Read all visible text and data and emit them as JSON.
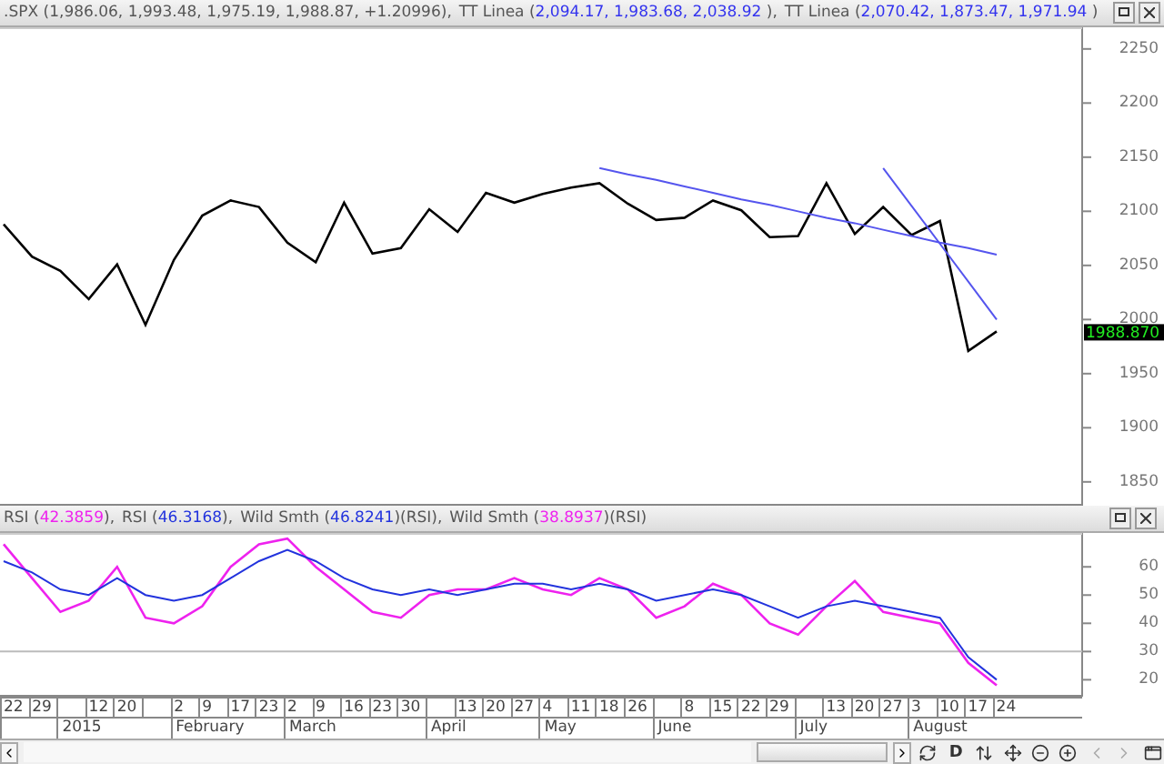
{
  "price_pane": {
    "legend": [
      {
        "name": ".SPX",
        "opening": " (",
        "values": "1,986.06, 1,993.48, 1,975.19, 1,988.87, +1.20996",
        "color": "#555555",
        "closing": "),"
      },
      {
        "name": "TT Linea",
        "opening": " (",
        "values": "2,094.17, 1,983.68, 2,038.92 ",
        "color": "#3333ee",
        "closing": "),"
      },
      {
        "name": "TT Linea",
        "opening": " (",
        "values": "2,070.42, 1,873.47, 1,971.94 ",
        "color": "#3333ee",
        "closing": ")"
      }
    ],
    "last_price": "1988.870",
    "chart_data": {
      "type": "line",
      "ylim": [
        1828,
        2270
      ],
      "yticks": [
        1850,
        1900,
        1950,
        2000,
        2050,
        2100,
        2150,
        2200,
        2250
      ],
      "series": [
        {
          "color": "#000000",
          "values": [
            2088,
            2058,
            2045,
            2019,
            2051,
            1995,
            2055,
            2096,
            2110,
            2104,
            2071,
            2053,
            2108,
            2061,
            2066,
            2102,
            2081,
            2117,
            2108,
            2116,
            2122,
            2126,
            2107,
            2092,
            2094,
            2110,
            2101,
            2076,
            2077,
            2126,
            2079,
            2104,
            2078,
            2091,
            1971,
            1989
          ]
        },
        {
          "color": "#5555ee",
          "values": [
            null,
            null,
            null,
            null,
            null,
            null,
            null,
            null,
            null,
            null,
            null,
            null,
            null,
            null,
            null,
            null,
            null,
            null,
            null,
            null,
            null,
            2140,
            2134,
            2129,
            2123,
            2117,
            2111,
            2106,
            2100,
            2094,
            2089,
            2083,
            2077,
            2071,
            2066,
            2060
          ]
        },
        {
          "color": "#5555ee",
          "values": [
            null,
            null,
            null,
            null,
            null,
            null,
            null,
            null,
            null,
            null,
            null,
            null,
            null,
            null,
            null,
            null,
            null,
            null,
            null,
            null,
            null,
            null,
            null,
            null,
            null,
            null,
            null,
            null,
            null,
            null,
            null,
            2140,
            2105,
            2070,
            2035,
            2000
          ]
        }
      ]
    }
  },
  "rsi_pane": {
    "legend": [
      {
        "name": "RSI",
        "opening": " (",
        "values": "42.3859",
        "color": "#ee22ee",
        "closing": "),"
      },
      {
        "name": "RSI",
        "opening": " (",
        "values": "46.3168",
        "color": "#2233dd",
        "closing": "),"
      },
      {
        "name": "Wild Smth",
        "opening": " (",
        "values": "46.8241",
        "color": "#2233dd",
        "closing": ")(RSI),"
      },
      {
        "name": "Wild Smth",
        "opening": " (",
        "values": "38.8937",
        "color": "#ee22ee",
        "closing": ")(RSI)"
      }
    ],
    "chart_data": {
      "type": "line",
      "ylim": [
        14,
        72
      ],
      "yticks": [
        20,
        30,
        40,
        50,
        60
      ],
      "series": [
        {
          "color": "#ee22ee",
          "values": [
            68,
            56,
            44,
            48,
            60,
            42,
            40,
            46,
            60,
            68,
            70,
            60,
            52,
            44,
            42,
            50,
            52,
            52,
            56,
            52,
            50,
            56,
            52,
            42,
            46,
            54,
            50,
            40,
            36,
            46,
            55,
            44,
            42,
            40,
            26,
            18
          ]
        },
        {
          "color": "#2233dd",
          "values": [
            62,
            58,
            52,
            50,
            56,
            50,
            48,
            50,
            56,
            62,
            66,
            62,
            56,
            52,
            50,
            52,
            50,
            52,
            54,
            54,
            52,
            54,
            52,
            48,
            50,
            52,
            50,
            46,
            42,
            46,
            48,
            46,
            44,
            42,
            28,
            20
          ]
        }
      ]
    }
  },
  "date_axis": {
    "weeks": [
      {
        "kind": "day",
        "label": "22"
      },
      {
        "kind": "day",
        "label": "29"
      },
      {
        "kind": "gap",
        "month": "2015"
      },
      {
        "kind": "day",
        "label": "12"
      },
      {
        "kind": "day",
        "label": "20"
      },
      {
        "kind": "gap"
      },
      {
        "kind": "day",
        "label": "2",
        "month": "February"
      },
      {
        "kind": "day",
        "label": "9"
      },
      {
        "kind": "day",
        "label": "17"
      },
      {
        "kind": "day",
        "label": "23"
      },
      {
        "kind": "day",
        "label": "2",
        "month": "March"
      },
      {
        "kind": "day",
        "label": "9"
      },
      {
        "kind": "day",
        "label": "16"
      },
      {
        "kind": "day",
        "label": "23"
      },
      {
        "kind": "day",
        "label": "30"
      },
      {
        "kind": "gap",
        "month": "April"
      },
      {
        "kind": "day",
        "label": "13"
      },
      {
        "kind": "day",
        "label": "20"
      },
      {
        "kind": "day",
        "label": "27"
      },
      {
        "kind": "day",
        "label": "4",
        "month": "May"
      },
      {
        "kind": "day",
        "label": "11"
      },
      {
        "kind": "day",
        "label": "18"
      },
      {
        "kind": "day",
        "label": "26"
      },
      {
        "kind": "gap",
        "month": "June"
      },
      {
        "kind": "day",
        "label": "8"
      },
      {
        "kind": "day",
        "label": "15"
      },
      {
        "kind": "day",
        "label": "22"
      },
      {
        "kind": "day",
        "label": "29"
      },
      {
        "kind": "gap",
        "month": "July"
      },
      {
        "kind": "day",
        "label": "13"
      },
      {
        "kind": "day",
        "label": "20"
      },
      {
        "kind": "day",
        "label": "27"
      },
      {
        "kind": "day",
        "label": "3",
        "month": "August"
      },
      {
        "kind": "day",
        "label": "10"
      },
      {
        "kind": "day",
        "label": "17"
      },
      {
        "kind": "day",
        "label": "24"
      }
    ]
  },
  "toolbar": {
    "period_button": "D"
  }
}
